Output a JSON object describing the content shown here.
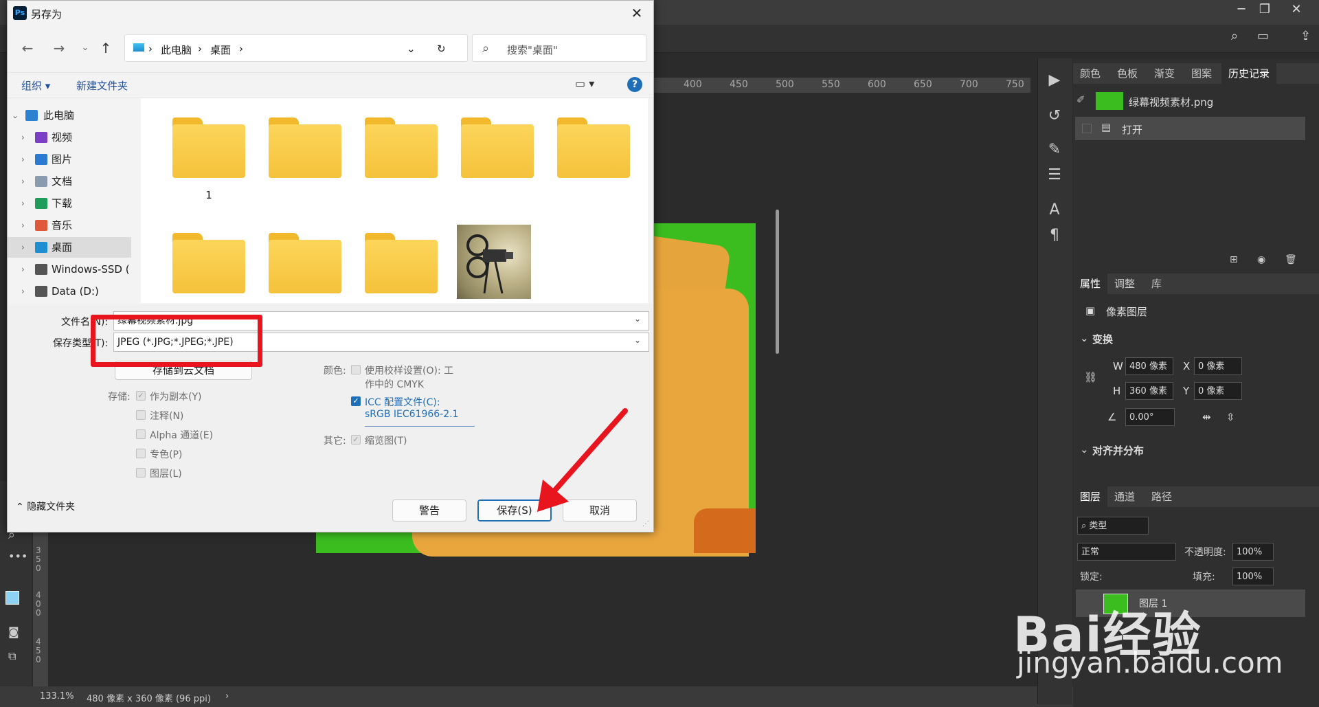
{
  "dialog": {
    "title": "另存为",
    "app_icon": "Ps",
    "breadcrumb": [
      "此电脑",
      "桌面"
    ],
    "search_placeholder": "搜索\"桌面\"",
    "toolbar": {
      "organize": "组织",
      "new_folder": "新建文件夹",
      "help": "?"
    },
    "nav_items": [
      {
        "label": "此电脑",
        "icon": "computer-icon",
        "color": "#2a82d0"
      },
      {
        "label": "视频",
        "icon": "video-icon",
        "color": "#7b3fc4"
      },
      {
        "label": "图片",
        "icon": "pictures-icon",
        "color": "#2a7ad0"
      },
      {
        "label": "文档",
        "icon": "documents-icon",
        "color": "#8a9bb0"
      },
      {
        "label": "下载",
        "icon": "download-icon",
        "color": "#1d9c5a"
      },
      {
        "label": "音乐",
        "icon": "music-icon",
        "color": "#e0583a"
      },
      {
        "label": "桌面",
        "icon": "desktop-icon",
        "color": "#1d8ed0"
      },
      {
        "label": "Windows-SSD (",
        "icon": "drive-icon",
        "color": "#555555"
      },
      {
        "label": "Data (D:)",
        "icon": "drive-icon",
        "color": "#555555"
      }
    ],
    "folder_labels": [
      "",
      "",
      "",
      "",
      "",
      "1"
    ],
    "filename_label": "文件名(N):",
    "filename_value": "绿幕视频素材.jpg",
    "filetype_label": "保存类型(T):",
    "filetype_value": "JPEG (*.JPG;*.JPEG;*.JPE)",
    "cloud_button": "存储到云文档",
    "storage_label": "存储:",
    "storage_options": [
      "作为副本(Y)",
      "注释(N)",
      "Alpha 通道(E)",
      "专色(P)",
      "图层(L)"
    ],
    "color_label": "颜色:",
    "proof_setup_line1": "使用校样设置(O): 工",
    "proof_setup_line2": "作中的 CMYK",
    "icc_line1": "ICC 配置文件(C):",
    "icc_line2": "sRGB IEC61966-2.1",
    "other_label": "其它:",
    "thumbnail_option": "缩览图(T)",
    "hide_folders": "隐藏文件夹",
    "warning_button": "警告",
    "save_button": "保存(S)",
    "cancel_button": "取消"
  },
  "ps": {
    "ruler_ticks": [
      "400",
      "450",
      "500",
      "550",
      "600",
      "650",
      "700",
      "750"
    ],
    "ruler_v_ticks": [
      "3\n5\n0",
      "4\n0\n0",
      "4\n5\n0"
    ],
    "status_zoom": "133.1%",
    "status_info": "480 像素 x 360 像素 (96 ppi)",
    "top_tabs": [
      "颜色",
      "色板",
      "渐变",
      "图案",
      "历史记录"
    ],
    "history_items": [
      {
        "label": "绿幕视频素材.png"
      },
      {
        "label": "打开"
      }
    ],
    "prop_tabs": [
      "属性",
      "调整",
      "库"
    ],
    "pixel_layer": "像素图层",
    "transform_title": "变换",
    "w_label": "W",
    "w_value": "480 像素",
    "h_label": "H",
    "h_value": "360 像素",
    "x_label": "X",
    "x_value": "0 像素",
    "y_label": "Y",
    "y_value": "0 像素",
    "angle_value": "0.00°",
    "align_title": "对齐并分布",
    "layer_tabs": [
      "图层",
      "通道",
      "路径"
    ],
    "filter_type": "类型",
    "blend_mode": "正常",
    "opacity_label": "不透明度:",
    "opacity_value": "100%",
    "lock_label": "锁定:",
    "fill_label": "填充:",
    "fill_value": "100%",
    "layer_name": "图层 1"
  },
  "watermark": {
    "line1": "Bai经验",
    "line2": "jingyan.baidu.com"
  },
  "colors": {
    "annotation_red": "#e8141e",
    "accent": "#1f6fb8",
    "canvas_green": "#3bbd1f"
  }
}
